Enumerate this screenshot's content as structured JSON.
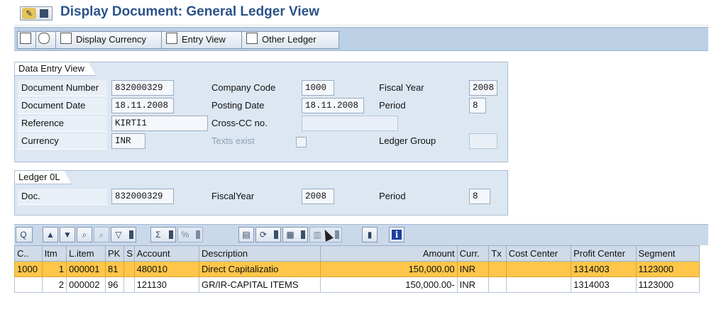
{
  "title": "Display Document: General Ledger View",
  "app_toolbar": {
    "display_currency": "Display Currency",
    "entry_view": "Entry View",
    "other_ledger": "Other Ledger"
  },
  "data_entry": {
    "group_title": "Data Entry View",
    "document_number_label": "Document Number",
    "document_number": "832000329",
    "company_code_label": "Company Code",
    "company_code": "1000",
    "fiscal_year_label": "Fiscal Year",
    "fiscal_year": "2008",
    "document_date_label": "Document Date",
    "document_date": "18.11.2008",
    "posting_date_label": "Posting Date",
    "posting_date": "18.11.2008",
    "period_label": "Period",
    "period": "8",
    "reference_label": "Reference",
    "reference": "KIRTI1",
    "cross_cc_label": "Cross-CC no.",
    "cross_cc": "",
    "currency_label": "Currency",
    "currency": "INR",
    "texts_exist_label": "Texts exist",
    "ledger_group_label": "Ledger Group",
    "ledger_group": ""
  },
  "ledger": {
    "group_title": "Ledger 0L",
    "doc_label": "Doc.",
    "doc": "832000329",
    "fiscal_year_label": "FiscalYear",
    "fiscal_year": "2008",
    "period_label": "Period",
    "period": "8"
  },
  "table": {
    "columns": [
      "C..",
      "Itm",
      "L.item",
      "PK",
      "S",
      "Account",
      "Description",
      "Amount",
      "Curr.",
      "Tx",
      "Cost Center",
      "Profit Center",
      "Segment"
    ],
    "rows": [
      [
        "1000",
        "1",
        "000001",
        "81",
        "",
        "480010",
        "Direct Capitalizatio",
        "150,000.00",
        "INR",
        "",
        "",
        "1314003",
        "1123000"
      ],
      [
        "",
        "2",
        "000002",
        "96",
        "",
        "121130",
        "GR/IR-CAPITAL ITEMS",
        "150,000.00-",
        "INR",
        "",
        "",
        "1314003",
        "1123000"
      ]
    ]
  },
  "colors": {
    "title": "#2b5388",
    "selected_row": "#ffc64a",
    "toolbar": "#bcd0e6"
  }
}
